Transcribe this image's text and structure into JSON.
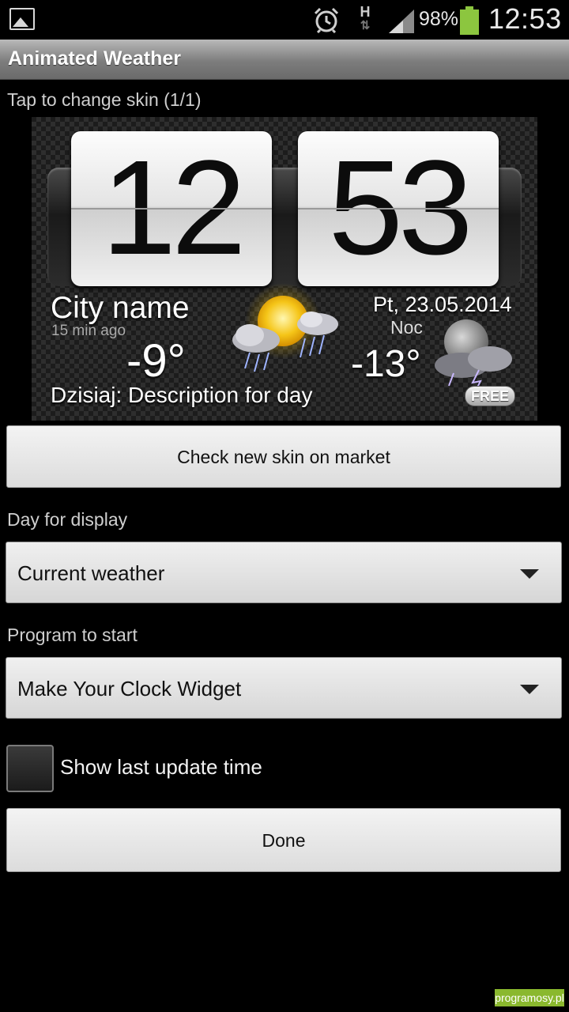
{
  "status_bar": {
    "icons": [
      "gallery-icon",
      "alarm-icon",
      "hspa-icon",
      "signal-icon",
      "battery-icon"
    ],
    "network_type": "H",
    "battery_percent": "98%",
    "battery_level": 0.98,
    "time": "12:53"
  },
  "app": {
    "title": "Animated Weather"
  },
  "skin": {
    "tap_label": "Tap to change skin (1/1)"
  },
  "widget": {
    "hour": "12",
    "minute": "53",
    "city": "City name",
    "updated_ago": "15 min ago",
    "temperature": "-9°",
    "description": "Dzisiaj: Description for day",
    "date": "Pt, 23.05.2014",
    "night_label": "Noc",
    "night_temperature": "-13°",
    "badge": "FREE"
  },
  "buttons": {
    "check_skin": "Check new skin on market",
    "done": "Done"
  },
  "day_display": {
    "label": "Day for display",
    "value": "Current weather"
  },
  "program_start": {
    "label": "Program to start",
    "value": "Make Your Clock Widget"
  },
  "show_update": {
    "label": "Show last update time",
    "checked": false
  },
  "watermark": "programosy.pl",
  "colors": {
    "background": "#000000",
    "battery": "#8cc63f",
    "watermark": "#8ab82e"
  }
}
